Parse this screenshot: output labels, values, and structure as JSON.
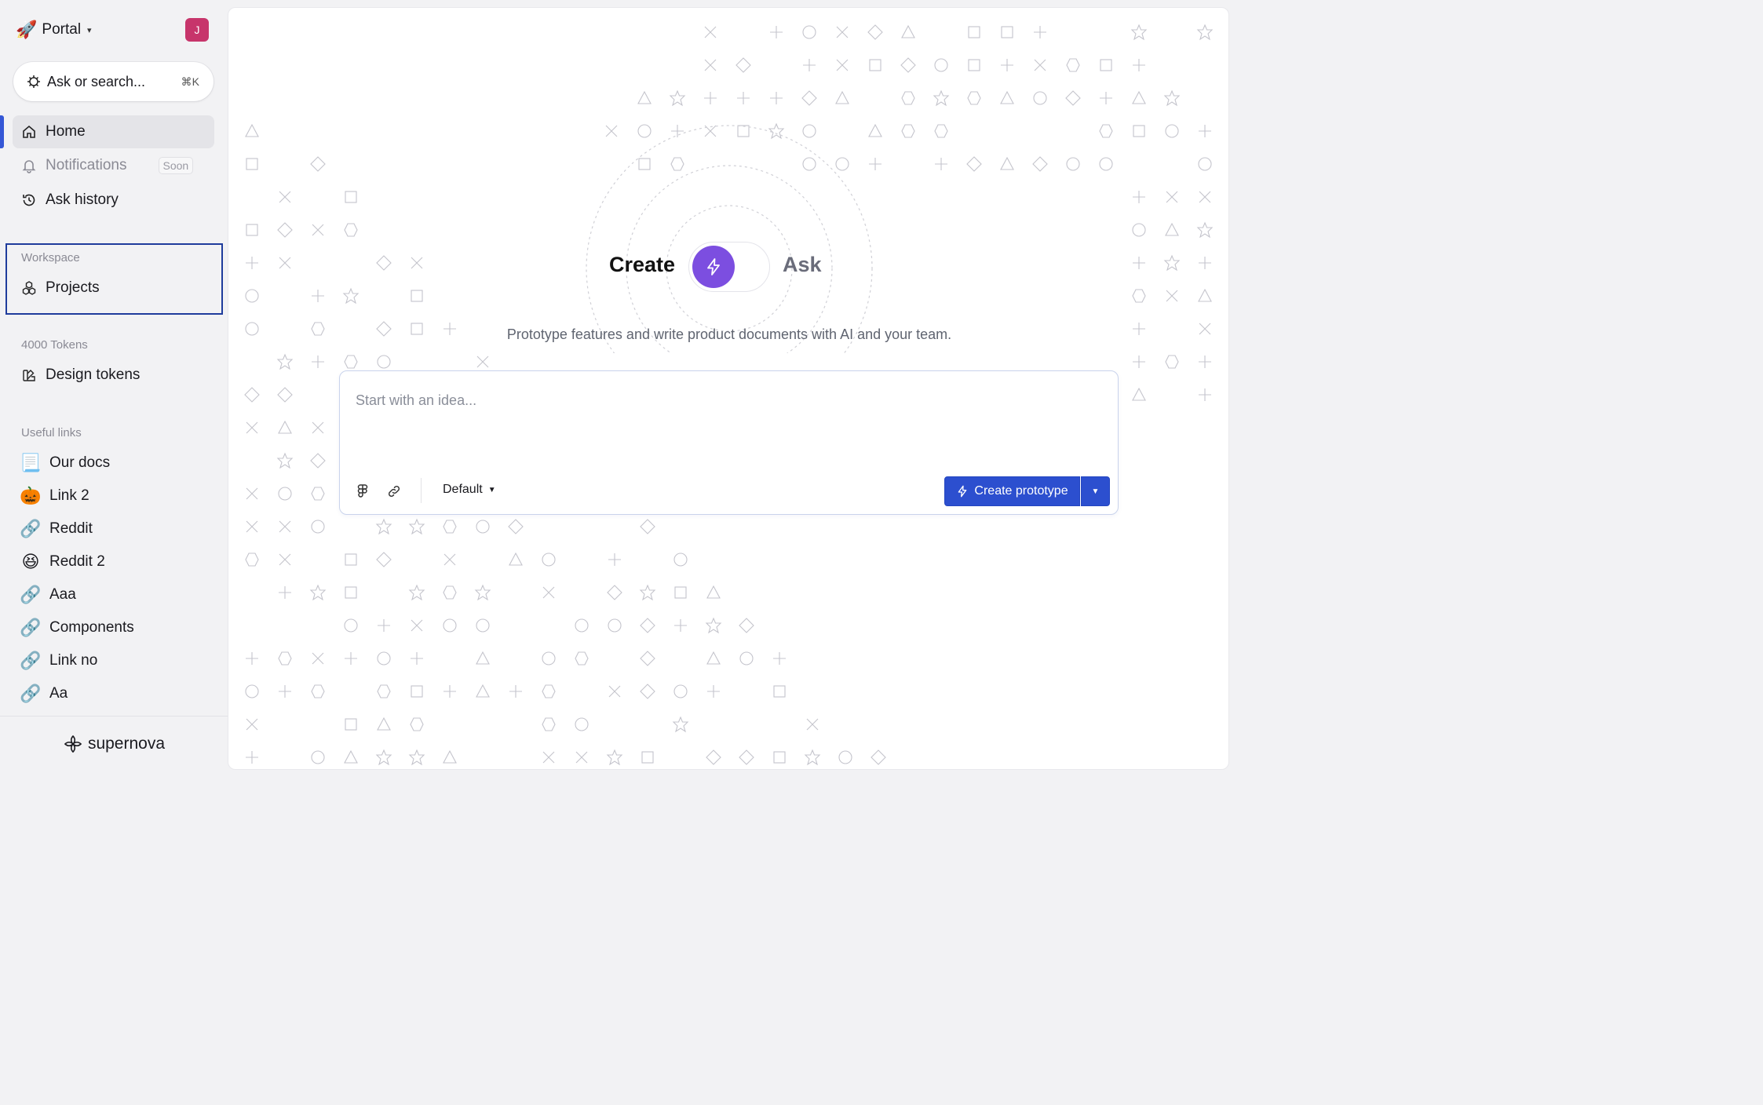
{
  "header": {
    "workspace_name": "Portal",
    "workspace_emoji": "🚀",
    "avatar_initial": "J",
    "avatar_color": "#c7356b"
  },
  "search": {
    "label": "Ask or search...",
    "shortcut": "⌘K"
  },
  "nav": {
    "home": "Home",
    "notifications": "Notifications",
    "notifications_badge": "Soon",
    "ask_history": "Ask history"
  },
  "workspace_section": {
    "label": "Workspace",
    "projects": "Projects"
  },
  "tokens_section": {
    "label": "4000 Tokens",
    "design_tokens": "Design tokens"
  },
  "useful_links": {
    "label": "Useful links",
    "items": [
      {
        "label": "Our docs",
        "emoji": "📃"
      },
      {
        "label": "Link 2",
        "emoji": "🎃"
      },
      {
        "label": "Reddit",
        "emoji": "🔗"
      },
      {
        "label": "Reddit 2",
        "emoji": "😆"
      },
      {
        "label": "Aaa",
        "emoji": "🔗"
      },
      {
        "label": "Components",
        "emoji": "🔗"
      },
      {
        "label": "Link no",
        "emoji": "🔗"
      },
      {
        "label": "Aa",
        "emoji": "🔗"
      }
    ]
  },
  "footer": {
    "brand": "supernova"
  },
  "main": {
    "toggle_left": "Create",
    "toggle_right": "Ask",
    "subtitle": "Prototype features and write product documents with AI and your team.",
    "prompt_placeholder": "Start with an idea...",
    "mode_select": "Default",
    "create_button": "Create prototype"
  },
  "colors": {
    "accent": "#2c4fcf",
    "toggle_knob": "#7c4ee0",
    "active_bar": "#3557d6",
    "highlight_border": "#1f3c9c"
  }
}
